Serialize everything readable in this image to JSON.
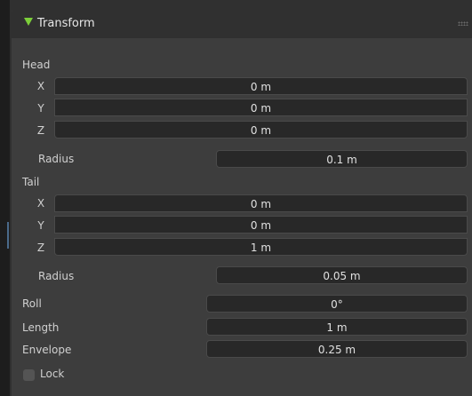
{
  "panel": {
    "title": "Transform",
    "expanded": true
  },
  "head": {
    "section_label": "Head",
    "x_label": "X",
    "x_value": "0 m",
    "y_label": "Y",
    "y_value": "0 m",
    "z_label": "Z",
    "z_value": "0 m",
    "radius_label": "Radius",
    "radius_value": "0.1 m"
  },
  "tail": {
    "section_label": "Tail",
    "x_label": "X",
    "x_value": "0 m",
    "y_label": "Y",
    "y_value": "0 m",
    "z_label": "Z",
    "z_value": "1 m",
    "radius_label": "Radius",
    "radius_value": "0.05 m"
  },
  "roll": {
    "label": "Roll",
    "value": "0°"
  },
  "length": {
    "label": "Length",
    "value": "1 m"
  },
  "envelope": {
    "label": "Envelope",
    "value": "0.25 m"
  },
  "lock": {
    "label": "Lock",
    "checked": false
  },
  "colors": {
    "caret": "#7ccf3a",
    "field_bg": "#282828",
    "panel_bg": "#3d3d3d"
  }
}
